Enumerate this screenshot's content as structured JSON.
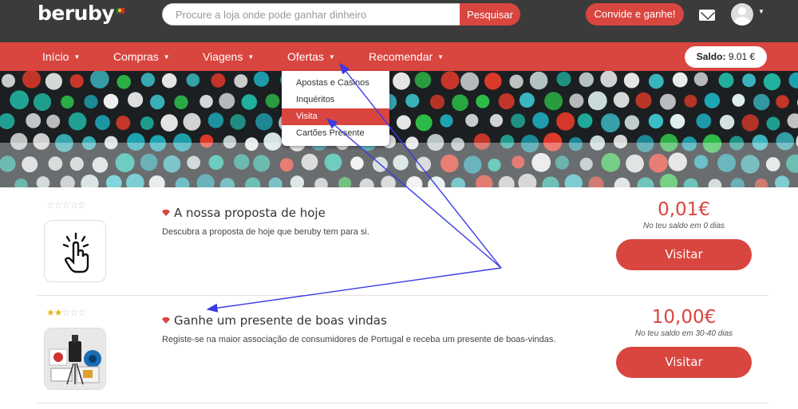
{
  "header": {
    "logo": "beruby",
    "search_placeholder": "Procure a loja onde pode ganhar dinheiro",
    "search_button": "Pesquisar",
    "invite_button": "Convide e ganhe!"
  },
  "nav": {
    "items": [
      {
        "label": "Início"
      },
      {
        "label": "Compras"
      },
      {
        "label": "Viagens"
      },
      {
        "label": "Ofertas"
      },
      {
        "label": "Recomendar"
      }
    ],
    "balance_label": "Saldo:",
    "balance_value": "9.01 €"
  },
  "dropdown": {
    "items": [
      {
        "label": "Apostas e Casinos"
      },
      {
        "label": "Inquéritos"
      },
      {
        "label": "Visita"
      },
      {
        "label": "Cartões Presente"
      }
    ],
    "active_item": "Visita"
  },
  "offers": [
    {
      "rating_of_5": 0,
      "title": "A nossa proposta de hoje",
      "description": "Descubra a proposta de hoje que beruby tem para si.",
      "amount": "0,01€",
      "note": "No teu saldo em 0 dias",
      "button": "Visitar",
      "icon": "tap-hand-icon"
    },
    {
      "rating_of_5": 2,
      "title": "Ganhe um presente de boas vindas",
      "description": "Registe-se na maior associação de consumidores de Portugal e receba um presente de boas-vindas.",
      "amount": "10,00€",
      "note": "No teu saldo em 30-40 dias",
      "button": "Visitar",
      "icon": "gift-products-icon"
    }
  ],
  "colors": {
    "brand_red": "#d9453f",
    "header_dark": "#3b3b3b",
    "annotation_arrow": "#3a3ae6"
  }
}
